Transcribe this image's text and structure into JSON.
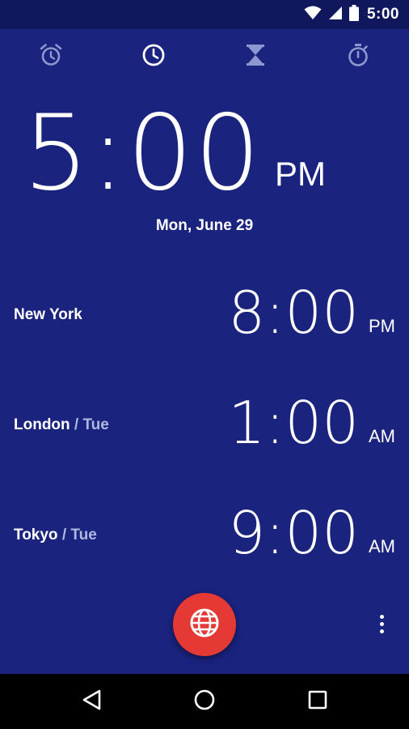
{
  "status_bar": {
    "time": "5:00",
    "icons": [
      "wifi-icon",
      "cell-signal-icon",
      "battery-icon"
    ]
  },
  "tabs": [
    {
      "name": "alarm",
      "icon": "alarm-icon",
      "active": false
    },
    {
      "name": "clock",
      "icon": "clock-icon",
      "active": true
    },
    {
      "name": "timer",
      "icon": "hourglass-icon",
      "active": false
    },
    {
      "name": "stopwatch",
      "icon": "stopwatch-icon",
      "active": false
    }
  ],
  "clock": {
    "time": "5:00",
    "ampm": "PM",
    "date": "Mon, June 29"
  },
  "cities": [
    {
      "name": "New York",
      "separator": "",
      "day": "",
      "time": "8:00",
      "ampm": "PM"
    },
    {
      "name": "London",
      "separator": " / ",
      "day": "Tue",
      "time": "1:00",
      "ampm": "AM"
    },
    {
      "name": "Tokyo",
      "separator": " / ",
      "day": "Tue",
      "time": "9:00",
      "ampm": "AM"
    }
  ],
  "fab": {
    "icon": "globe-icon",
    "color": "#e53935"
  },
  "overflow_menu": {
    "icon": "more-vertical-icon"
  },
  "nav_bar": {
    "icons": [
      "back-icon",
      "home-icon",
      "recents-icon"
    ]
  },
  "colors": {
    "background": "#1a237e",
    "status_bar": "#10175c",
    "accent": "#e53935"
  }
}
